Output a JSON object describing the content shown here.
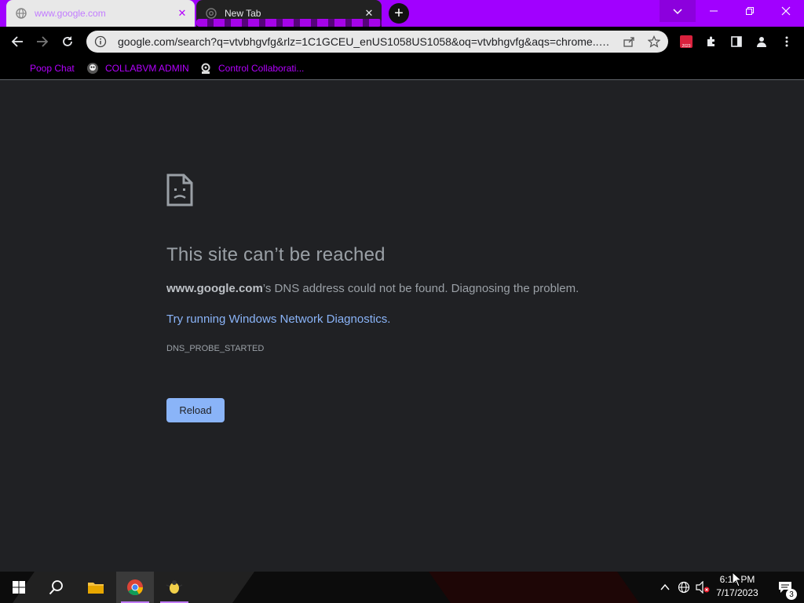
{
  "browser": {
    "tabs": [
      {
        "title": "www.google.com",
        "active": true
      },
      {
        "title": "New Tab",
        "active": false
      }
    ],
    "address_bar": {
      "url": "google.com/search?q=vtvbhgvfg&rlz=1C1GCEU_enUS1058US1058&oq=vtvbhgvfg&aqs=chrome..69i..."
    },
    "extension_badge": "2023",
    "bookmarks": [
      {
        "label": "Poop Chat",
        "icon": "none"
      },
      {
        "label": "COLLABVM ADMIN",
        "icon": "avatar-icon"
      },
      {
        "label": "Control Collaborati...",
        "icon": "gear-icon"
      }
    ],
    "accent_color": "#a100ff"
  },
  "error_page": {
    "title": "This site can’t be reached",
    "domain": "www.google.com",
    "description_rest": "’s DNS address could not be found. Diagnosing the problem.",
    "diagnostics_link": "Try running Windows Network Diagnostics.",
    "error_code": "DNS_PROBE_STARTED",
    "reload_label": "Reload"
  },
  "taskbar": {
    "apps": [
      "start-icon",
      "search-icon",
      "file-explorer-icon",
      "chrome-icon",
      "bug-icon"
    ],
    "clock": {
      "time": "6:13 PM",
      "date": "7/17/2023"
    },
    "notification_count": "3"
  }
}
